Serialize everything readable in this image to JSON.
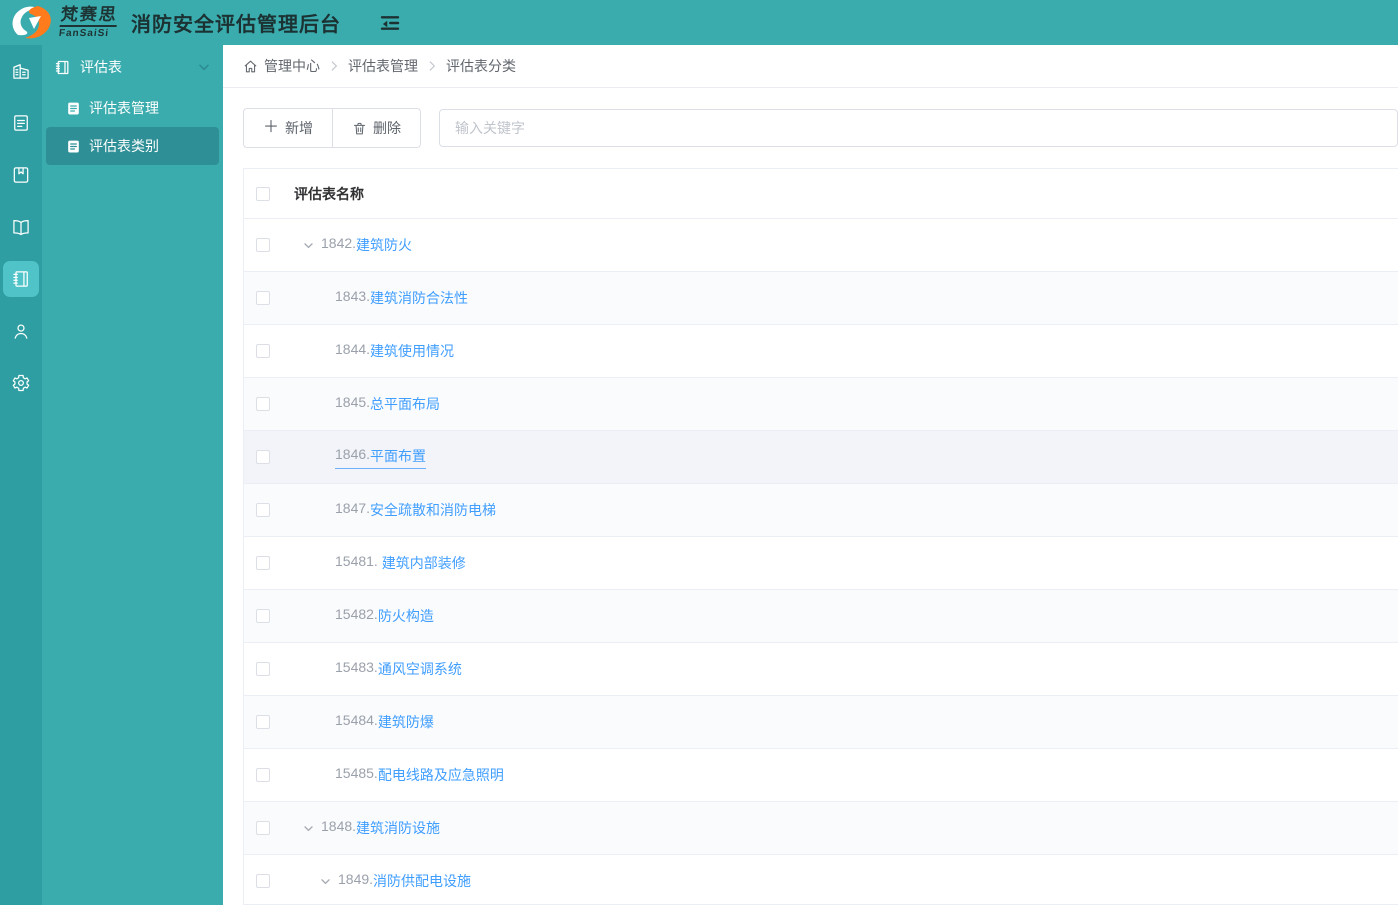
{
  "header": {
    "brand_cn": "梵赛思",
    "brand_en": "FanSaiSi",
    "app_title": "消防安全评估管理后台"
  },
  "icon_rail": {
    "icons": [
      "building-icon",
      "document-icon",
      "book-bookmark-icon",
      "open-book-icon",
      "notebook-icon",
      "user-icon",
      "gear-icon"
    ],
    "active_index": 4
  },
  "sidebar": {
    "group_label": "评估表",
    "items": [
      {
        "label": "评估表管理",
        "active": false
      },
      {
        "label": "评估表类别",
        "active": true
      }
    ]
  },
  "breadcrumb": {
    "items": [
      "管理中心",
      "评估表管理",
      "评估表分类"
    ]
  },
  "toolbar": {
    "add_label": "新增",
    "delete_label": "删除",
    "search_placeholder": "输入关键字"
  },
  "table": {
    "column_header": "评估表名称",
    "rows": [
      {
        "num": "1842.",
        "name": "建筑防火",
        "level": 0,
        "expandable": true
      },
      {
        "num": "1843.",
        "name": "建筑消防合法性",
        "level": 1,
        "expandable": false
      },
      {
        "num": "1844.",
        "name": "建筑使用情况",
        "level": 1,
        "expandable": false
      },
      {
        "num": "1845.",
        "name": "总平面布局",
        "level": 1,
        "expandable": false
      },
      {
        "num": "1846.",
        "name": "平面布置",
        "level": 1,
        "expandable": false,
        "hovered": true
      },
      {
        "num": "1847.",
        "name": "安全疏散和消防电梯",
        "level": 1,
        "expandable": false
      },
      {
        "num": "15481. ",
        "name": "建筑内部装修",
        "level": 1,
        "expandable": false
      },
      {
        "num": "15482.",
        "name": "防火构造",
        "level": 1,
        "expandable": false
      },
      {
        "num": "15483.",
        "name": "通风空调系统",
        "level": 1,
        "expandable": false
      },
      {
        "num": "15484.",
        "name": "建筑防爆",
        "level": 1,
        "expandable": false
      },
      {
        "num": "15485.",
        "name": "配电线路及应急照明",
        "level": 1,
        "expandable": false
      },
      {
        "num": "1848.",
        "name": "建筑消防设施",
        "level": 0,
        "expandable": true
      },
      {
        "num": "1849.",
        "name": "消防供配电设施",
        "level": 2,
        "expandable": true
      }
    ]
  },
  "colors": {
    "header_teal": "#3aacae",
    "rail_teal": "#2f9ea2",
    "rail_active": "#4fc3c7",
    "sidebar_active": "#2e8f96",
    "link_blue": "#409eff",
    "num_gray": "#9ba1ab",
    "border_gray": "#ebeef5",
    "stripe": "#fafbfd",
    "hover_row": "#f2f4f9",
    "logo_orange": "#ff7b1c"
  }
}
